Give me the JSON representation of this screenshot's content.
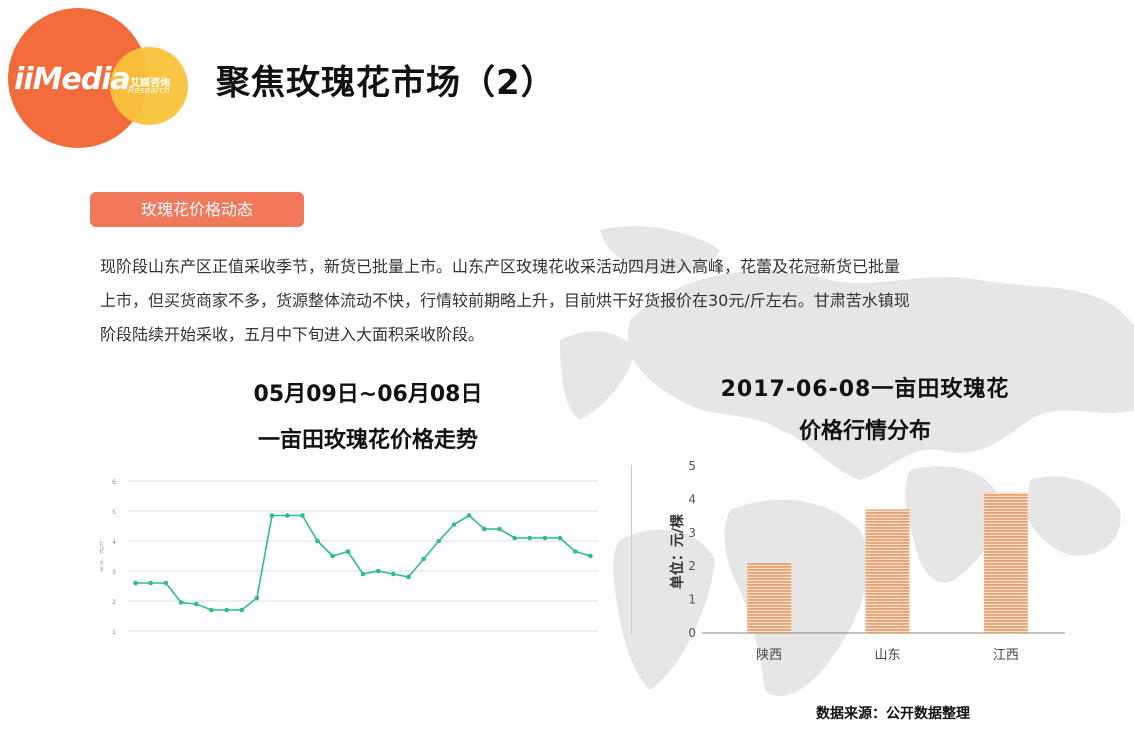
{
  "header": {
    "logo_brand": "iiMedia",
    "logo_cn": "艾媒咨询",
    "logo_en": "Research",
    "title": "聚焦玫瑰花市场（2）"
  },
  "section": {
    "tag": "玫瑰花价格动态",
    "lines": [
      "现阶段山东产区正值采收季节，新货已批量上市。山东产区玫瑰花收采活动四月进入高峰，花蕾及花冠新货已批量",
      "上市，但买货商家不多，货源整体流动不快，行情较前期略上升，目前烘干好货报价在30元/斤左右。甘肃苦水镇现",
      "阶段陆续开始采收，五月中下旬进入大面积采收阶段。"
    ]
  },
  "colors": {
    "line": "#2dbd8a",
    "bar": "#e8a070",
    "tag": "#f2785c",
    "logo_orange": "#f26b3a",
    "logo_yellow": "#f8c23a"
  },
  "chart_data": [
    {
      "type": "line",
      "title_lines": [
        "05月09日~06月08日",
        "一亩田玫瑰花价格走势"
      ],
      "ylabel": "单位：元/斤",
      "ylim": [
        1,
        6
      ],
      "yticks": [
        1,
        2,
        3,
        4,
        5,
        6
      ],
      "grid": true,
      "series": [
        {
          "values": [
            2.6,
            2.6,
            2.6,
            1.95,
            1.9,
            1.7,
            1.7,
            1.7,
            2.1,
            4.85,
            4.85,
            4.85,
            4.0,
            3.5,
            3.65,
            2.9,
            3.0,
            2.9,
            2.8,
            3.4,
            4.0,
            4.55,
            4.85,
            4.4,
            4.4,
            4.1,
            4.1,
            4.1,
            4.1,
            3.65,
            3.5
          ]
        }
      ]
    },
    {
      "type": "bar",
      "title_lines": [
        "2017-06-08一亩田玫瑰花",
        "价格行情分布"
      ],
      "categories": [
        "陕西",
        "山东",
        "江西"
      ],
      "values": [
        2.1,
        3.7,
        4.2
      ],
      "ylabel": "单位：元/棵",
      "ylim": [
        0,
        5
      ],
      "yticks": [
        0,
        1,
        2,
        3,
        4,
        5
      ],
      "grid": false
    }
  ],
  "footer": {
    "source": "数据来源：公开数据整理"
  }
}
